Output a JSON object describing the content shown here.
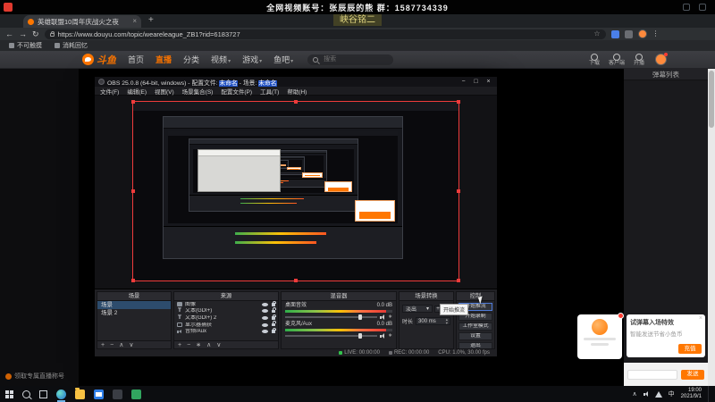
{
  "colors": {
    "accent": "#ff7700",
    "title_highlight": "#1e4fc2",
    "live_green": "#33c24d",
    "selection_red": "#ee3b3b"
  },
  "overlay": {
    "banner_text": "全网视频账号：张辰辰的熊  群：1587734339",
    "watermark": "峡谷铭二"
  },
  "browser": {
    "tab_title": "英雄联盟10周年庆战火之夜",
    "url": "https://www.douyu.com/topic/weareleague_ZB1?rid=6183727",
    "bookmarks": [
      "不可触摸",
      "消耗回忆"
    ]
  },
  "icons": {
    "back": "←",
    "forward": "→",
    "reload": "↻",
    "star": "☆",
    "menu": "⋮",
    "plus": "+",
    "minus": "−",
    "close": "×",
    "caret": "▾",
    "min": "−",
    "max": "□",
    "up": "∧",
    "down": "∨",
    "gear": "∗",
    "spin_up": "▴",
    "spin_down": "▾"
  },
  "site": {
    "logo": "斗鱼",
    "nav": [
      "首页",
      "直播",
      "分类",
      "视频",
      "游戏",
      "鱼吧"
    ],
    "search_placeholder": "搜索",
    "actions": [
      "下载",
      "客户端",
      "开播"
    ],
    "caption": "领取专属直播称号"
  },
  "chat": {
    "title": "弹幕列表",
    "promo_title": "试弹幕入场特效",
    "promo_desc": "智能发送节省小鱼币",
    "promo_button": "充值",
    "send_button": "发送"
  },
  "obs": {
    "title_pre": "OBS 25.0.8 (64-bit, windows) - 配置文件: ",
    "title_hl1": "未命名",
    "title_mid": " - 场景: ",
    "title_hl2": "未命名",
    "menu": [
      "文件(F)",
      "编辑(E)",
      "视图(V)",
      "场景集合(S)",
      "配置文件(P)",
      "工具(T)",
      "帮助(H)"
    ],
    "scenes": {
      "title": "场景",
      "items": [
        "场景",
        "场景 2"
      ]
    },
    "sources": {
      "title": "来源",
      "items": [
        "图像",
        "文本(GDI+)",
        "文本(GDI+) 2",
        "显示器捕获",
        "音频/Aux"
      ]
    },
    "mixer": {
      "title": "混音器",
      "channels": [
        {
          "name": "桌面音效",
          "db": "0.0 dB"
        },
        {
          "name": "麦克风/Aux",
          "db": "0.0 dB"
        }
      ]
    },
    "transitions": {
      "title": "场景转换",
      "transition": "淡出",
      "duration_label": "时长",
      "duration": "300 ms"
    },
    "controls": {
      "title": "控制",
      "buttons": [
        "开始推流",
        "开始录制",
        "工作室模式",
        "设置",
        "退出"
      ],
      "tooltip": "开始推流"
    },
    "status": {
      "live": "LIVE: 00:00:00",
      "rec": "REC: 00:00:00",
      "cpu": "CPU: 1.0%, 30.00 fps"
    }
  },
  "taskbar": {
    "lang": "中",
    "time": "19:00",
    "date": "2021/9/1"
  }
}
